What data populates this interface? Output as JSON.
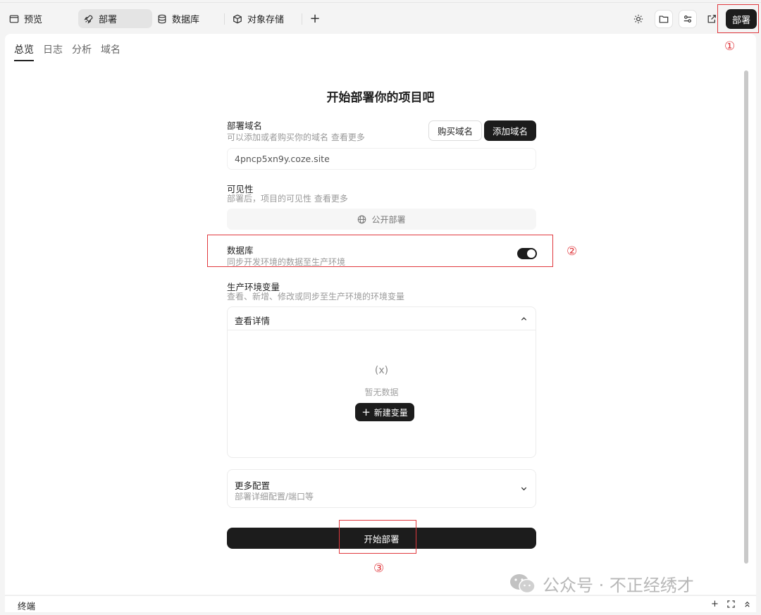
{
  "topbar": {
    "tabs": [
      {
        "label": "预览",
        "icon": "window-icon"
      },
      {
        "label": "部署",
        "icon": "rocket-icon",
        "active": true
      },
      {
        "label": "数据库",
        "icon": "database-icon"
      },
      {
        "label": "对象存储",
        "icon": "cube-icon"
      }
    ],
    "add_tab": "+",
    "deploy_label": "部署"
  },
  "subtabs": [
    "总览",
    "日志",
    "分析",
    "域名"
  ],
  "main": {
    "heading": "开始部署你的项目吧",
    "domain": {
      "title": "部署域名",
      "desc": "可以添加或者购买你的域名 查看更多",
      "buy_label": "购买域名",
      "add_label": "添加域名",
      "value": "4pncp5xn9y.coze.site"
    },
    "visibility": {
      "title": "可见性",
      "desc": "部署后，项目的可见性 查看更多",
      "public_label": "公开部署"
    },
    "database": {
      "title": "数据库",
      "desc": "同步开发环境的数据至生产环境",
      "enabled": true
    },
    "env": {
      "title": "生产环境变量",
      "desc": "查看、新增、修改或同步至生产环境的环境变量",
      "card_title": "查看详情",
      "empty_icon": "(x)",
      "empty_text": "暂无数据",
      "new_label": "新建变量"
    },
    "more": {
      "title": "更多配置",
      "desc": "部署详细配置/端口等"
    },
    "start_label": "开始部署"
  },
  "annotations": {
    "one": "①",
    "two": "②",
    "three": "③"
  },
  "watermark": "公众号 · 不正经绣才",
  "bottombar": {
    "label": "终端"
  },
  "colors": {
    "accent": "#1c1c1c",
    "annotation": "#e0393e"
  }
}
